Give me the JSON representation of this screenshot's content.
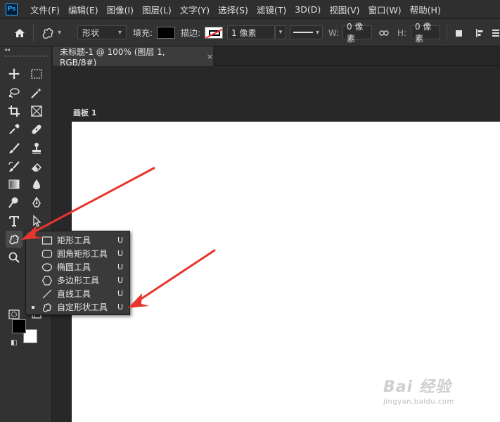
{
  "menubar": {
    "logo": "Ps",
    "items": [
      "文件(F)",
      "编辑(E)",
      "图像(I)",
      "图层(L)",
      "文字(Y)",
      "选择(S)",
      "滤镜(T)",
      "3D(D)",
      "视图(V)",
      "窗口(W)",
      "帮助(H)"
    ]
  },
  "options": {
    "mode": "形状",
    "fill_label": "填充:",
    "stroke_label": "描边:",
    "stroke_width": "1 像素",
    "w_label": "W:",
    "w_value": "0 像素",
    "h_label": "H:",
    "h_value": "0 像素"
  },
  "document": {
    "tab_title": "未标题-1 @ 100% (图层 1, RGB/8#)",
    "tab_close": "×",
    "artboard_label": "画板 1"
  },
  "flyout": {
    "items": [
      {
        "label": "矩形工具",
        "key": "U",
        "icon": "rectangle-icon"
      },
      {
        "label": "圆角矩形工具",
        "key": "U",
        "icon": "rounded-rectangle-icon"
      },
      {
        "label": "椭圆工具",
        "key": "U",
        "icon": "ellipse-icon"
      },
      {
        "label": "多边形工具",
        "key": "U",
        "icon": "polygon-icon"
      },
      {
        "label": "直线工具",
        "key": "U",
        "icon": "line-icon"
      },
      {
        "label": "自定形状工具",
        "key": "U",
        "icon": "custom-shape-icon",
        "selected": true
      }
    ]
  },
  "watermark": {
    "main": "Bai 经验",
    "sub": "jingyan.baidu.com"
  },
  "colors": {
    "accent_ps": "#31a8ff",
    "annotation_arrow": "#e8352d",
    "foreground": "#000000",
    "background": "#ffffff"
  }
}
